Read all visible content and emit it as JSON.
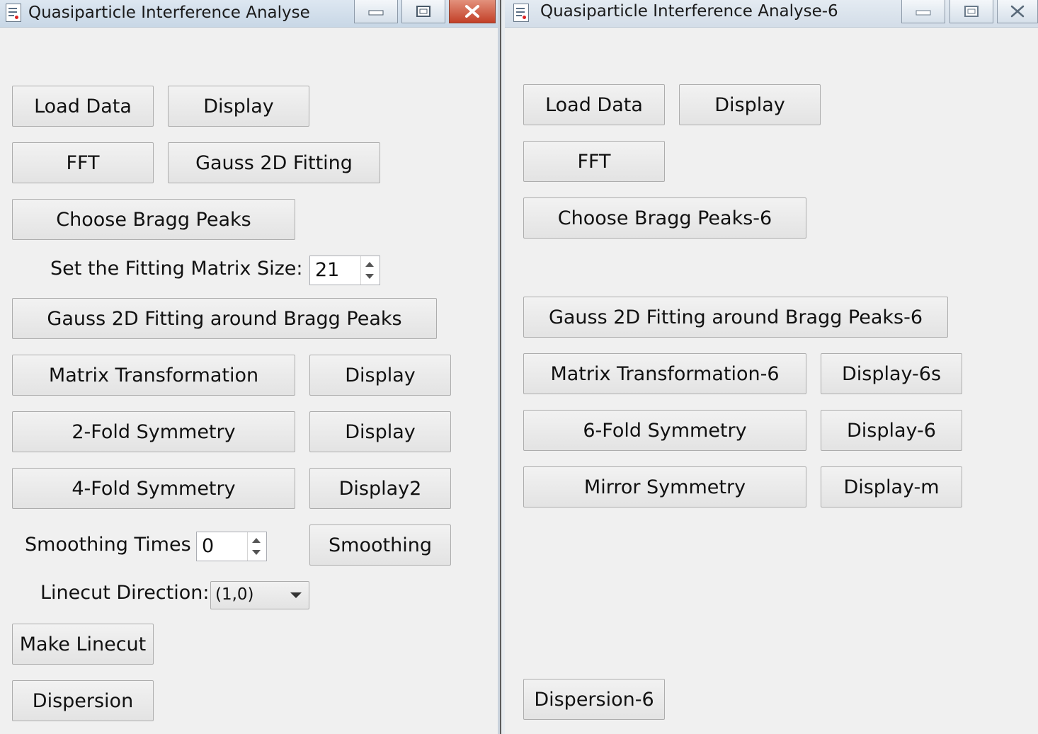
{
  "window1": {
    "title": "Quasiparticle Interference Analyse",
    "buttons": {
      "load_data": "Load Data",
      "display": "Display",
      "fft": "FFT",
      "gauss_2d_fitting": "Gauss 2D Fitting",
      "choose_bragg_peaks": "Choose Bragg Peaks",
      "gauss_fit_around_bragg": "Gauss 2D Fitting around Bragg Peaks",
      "matrix_transformation": "Matrix Transformation",
      "display_matrix": "Display",
      "two_fold": "2-Fold Symmetry",
      "display_two_fold": "Display",
      "four_fold": "4-Fold Symmetry",
      "display_four_fold": "Display2",
      "smoothing": "Smoothing",
      "make_linecut": "Make Linecut",
      "dispersion": "Dispersion"
    },
    "fitting_matrix_size": {
      "label": "Set the Fitting Matrix Size:",
      "value": "21"
    },
    "smoothing_times": {
      "label": "Smoothing Times",
      "value": "0"
    },
    "linecut_direction": {
      "label": "Linecut Direction:",
      "value": "(1,0)"
    }
  },
  "window2": {
    "title": "Quasiparticle Interference Analyse-6",
    "buttons": {
      "load_data": "Load Data",
      "display": "Display",
      "fft": "FFT",
      "choose_bragg_peaks": "Choose Bragg Peaks-6",
      "gauss_fit_around_bragg": "Gauss 2D Fitting around Bragg Peaks-6",
      "matrix_transformation": "Matrix Transformation-6",
      "display_matrix": "Display-6s",
      "six_fold": "6-Fold Symmetry",
      "display_six_fold": "Display-6",
      "mirror": "Mirror Symmetry",
      "display_mirror": "Display-m",
      "dispersion": "Dispersion-6"
    }
  },
  "colors": {
    "window_bg": "#f0f0f0",
    "titlebar": "#d2dfec",
    "close_button": "#c84a32"
  }
}
